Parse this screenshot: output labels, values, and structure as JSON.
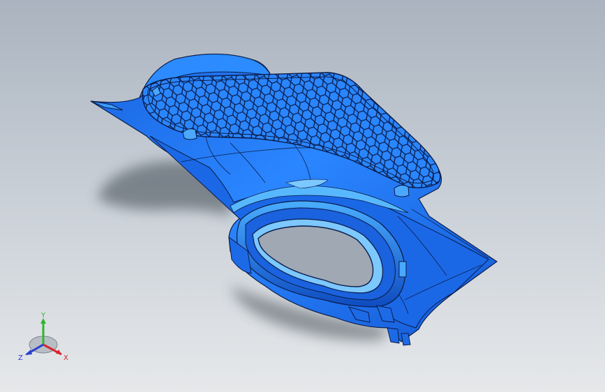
{
  "colors": {
    "part_base": "#1e73f0",
    "part_light": "#3fa0ff",
    "part_dark": "#0b3fa8",
    "edge": "#0a1c4a",
    "shadow": "#3e4650",
    "axis_x": "#d8252d",
    "axis_y": "#2fb52f",
    "axis_z": "#2a3fcf"
  },
  "triad": {
    "x_label": "X",
    "y_label": "Y",
    "z_label": "Z"
  },
  "model": {
    "icon": "3d-part-model-icon",
    "features": [
      "hex-mesh-grille",
      "oval-opening",
      "snap-clips"
    ]
  }
}
